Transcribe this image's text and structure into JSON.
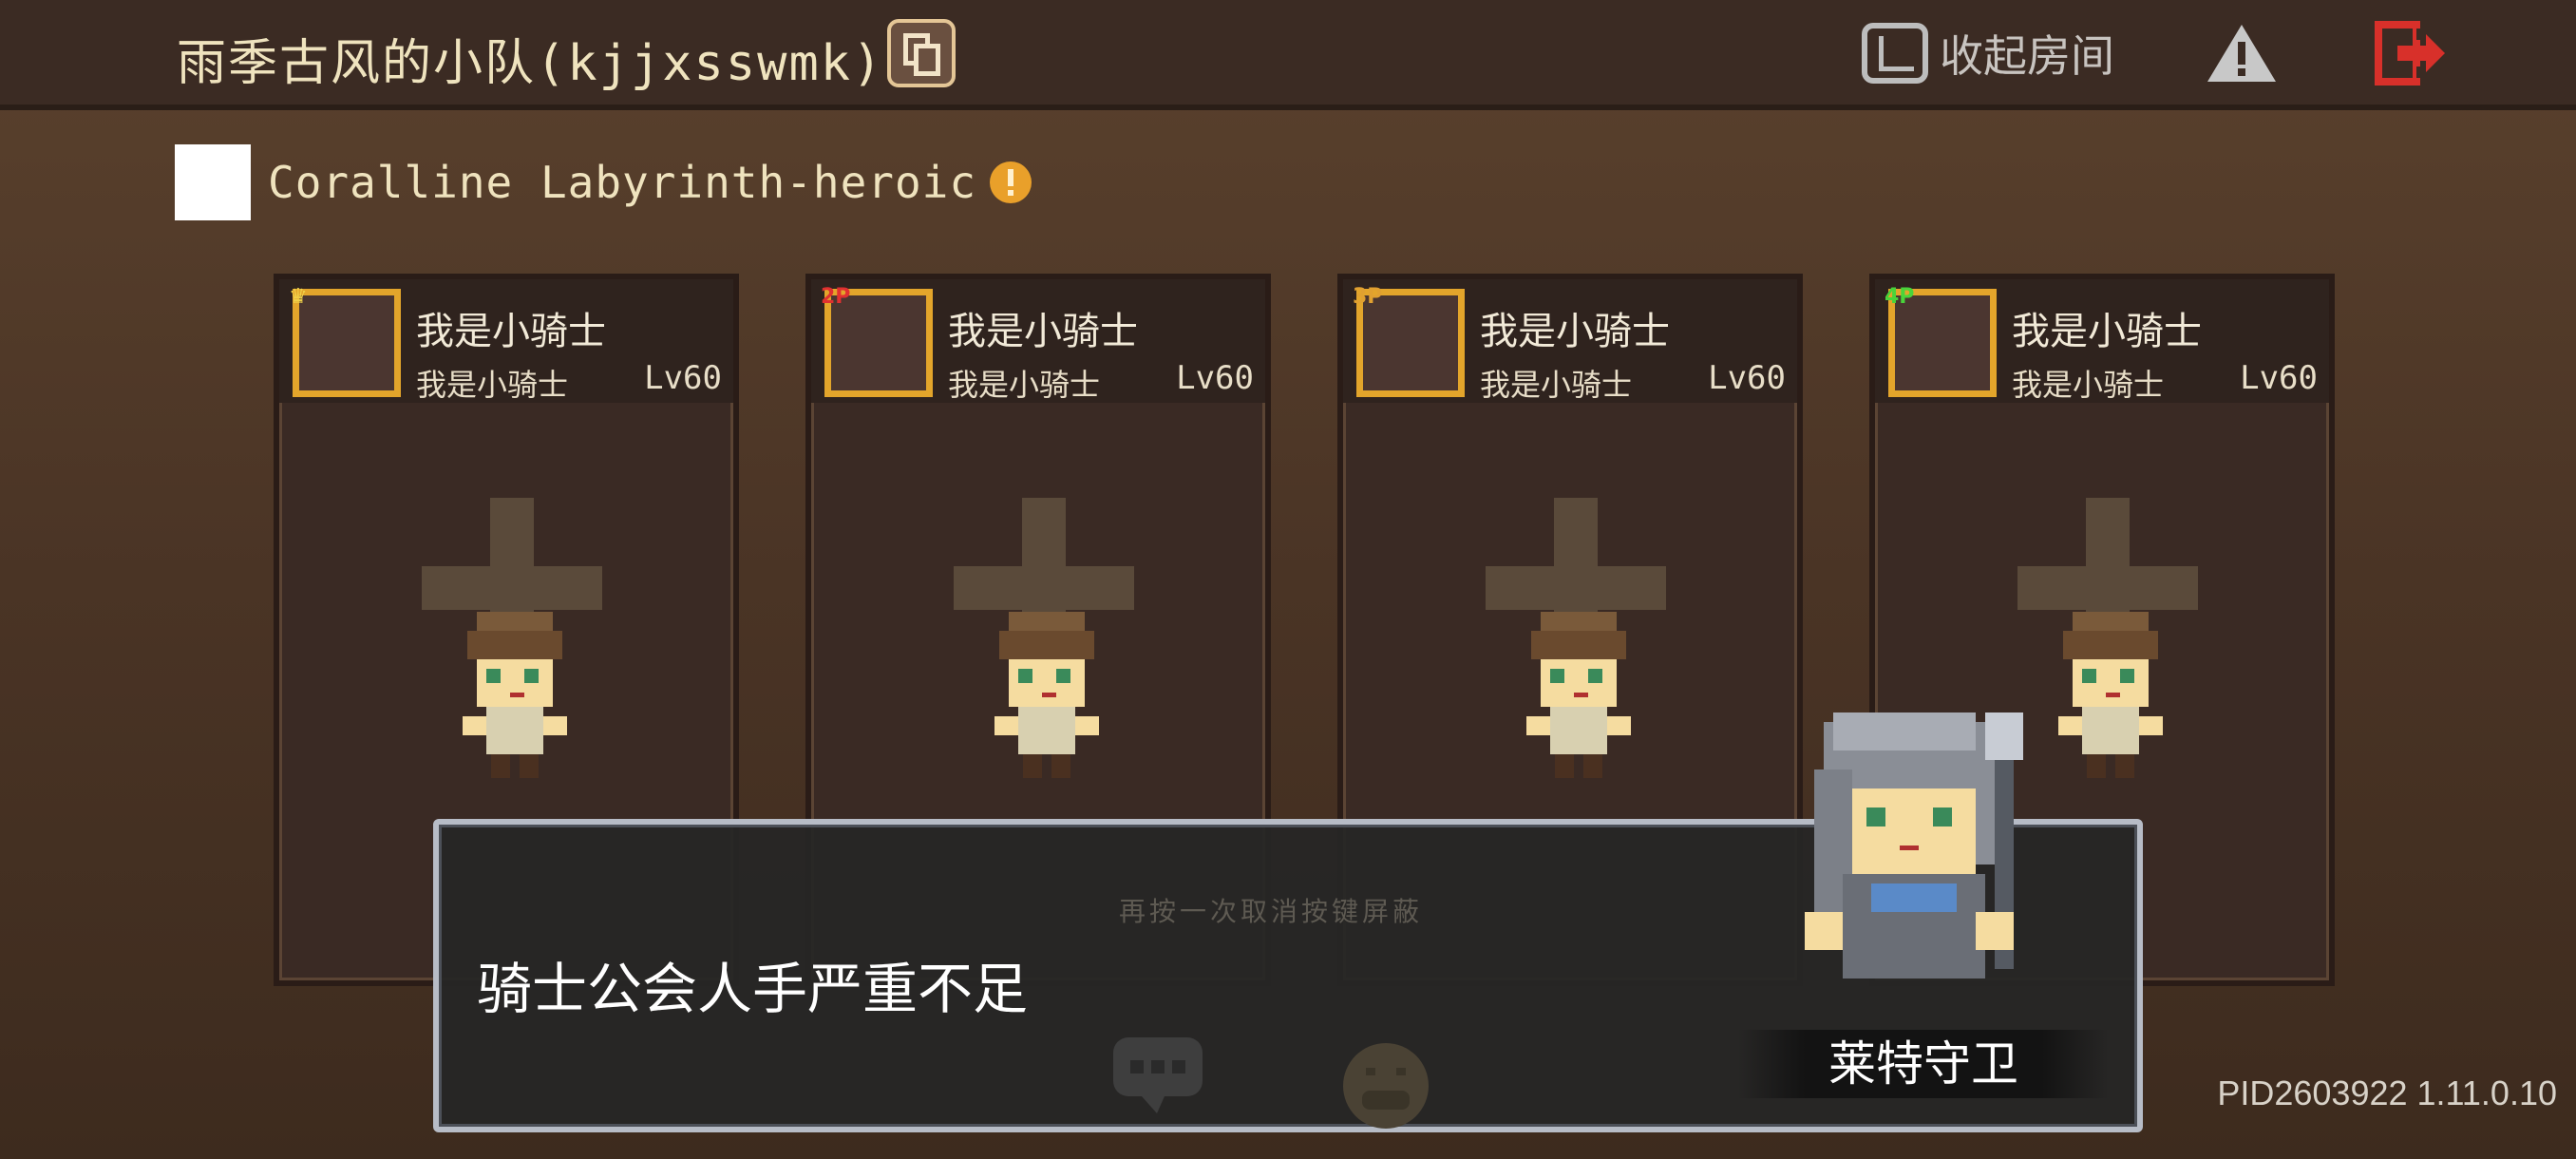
{
  "header": {
    "room_title": "雨季古风的小队(kjjxsswmk)",
    "copy_icon": "copy-icon",
    "collapse_label": "收起房间",
    "collapse_icon": "collapse-icon",
    "warning_icon": "warning-icon",
    "exit_icon": "exit-door-icon"
  },
  "dungeon": {
    "name": "Coralline Labyrinth-heroic",
    "info_icon": "exclamation-icon"
  },
  "slots": [
    {
      "role_badge": "♛",
      "role_color": "#f0d24a",
      "name": "我是小骑士",
      "subtitle": "我是小骑士",
      "level": "Lv60"
    },
    {
      "role_badge": "2P",
      "role_color": "#e03030",
      "name": "我是小骑士",
      "subtitle": "我是小骑士",
      "level": "Lv60"
    },
    {
      "role_badge": "3P",
      "role_color": "#e0a030",
      "name": "我是小骑士",
      "subtitle": "我是小骑士",
      "level": "Lv60"
    },
    {
      "role_badge": "4P",
      "role_color": "#49d43a",
      "name": "我是小骑士",
      "subtitle": "我是小骑士",
      "level": "Lv60"
    }
  ],
  "dialog": {
    "hint": "再按一次取消按键屏蔽",
    "text": "骑士公会人手严重不足",
    "speaker": "莱特守卫"
  },
  "version": "PID2603922 1.11.0.10",
  "colors": {
    "portrait_border": "#e3a52b",
    "accent_red": "#d8302a",
    "background": "#4a3425"
  }
}
